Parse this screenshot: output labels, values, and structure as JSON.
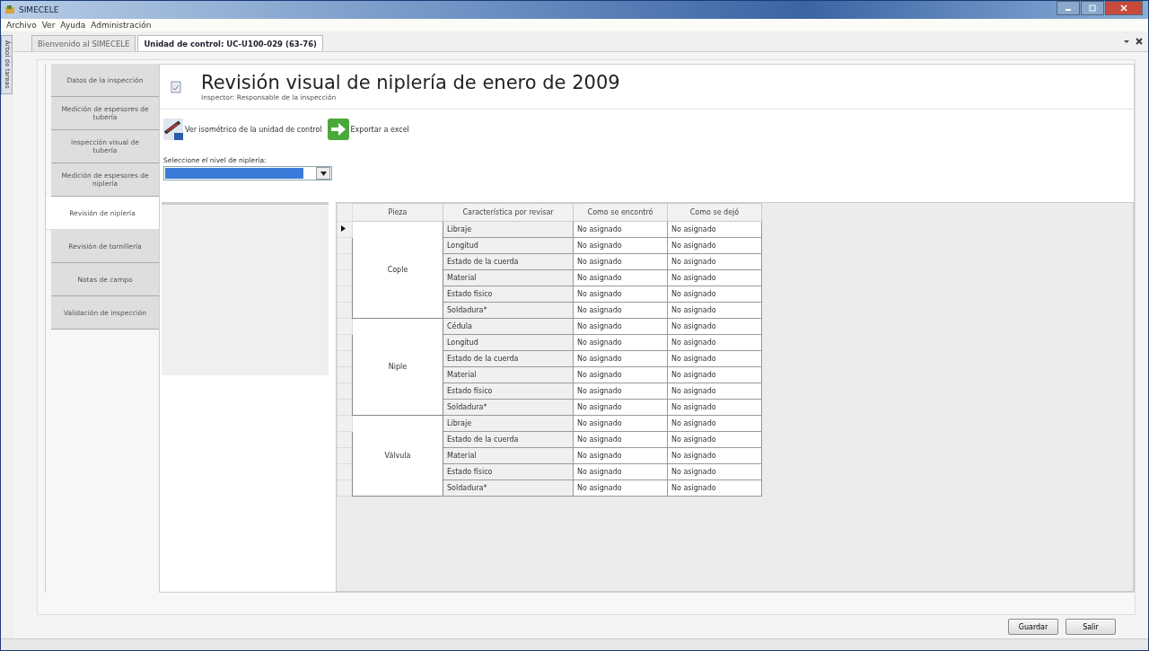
{
  "window": {
    "title": "SIMECELE"
  },
  "menu": [
    "Archivo",
    "Ver",
    "Ayuda",
    "Administración"
  ],
  "side_panel_tab": "Árbol de tareas",
  "doc_tabs": [
    {
      "label": "Bienvenido al SIMECELE",
      "selected": false
    },
    {
      "label": "Unidad de control: UC-U100-029 (63-76)",
      "selected": true
    }
  ],
  "nav_tabs": [
    {
      "label": "Datos de la inspección",
      "selected": false
    },
    {
      "label": "Medición de espesores de tubería",
      "selected": false
    },
    {
      "label": "Inspección visual de tubería",
      "selected": false
    },
    {
      "label": "Medición de espesores de niplería",
      "selected": false
    },
    {
      "label": "Revisión de niplería",
      "selected": true
    },
    {
      "label": "Revisión de tornillería",
      "selected": false
    },
    {
      "label": "Notas de campo",
      "selected": false
    },
    {
      "label": "Validación de inspección",
      "selected": false
    }
  ],
  "header": {
    "title": "Revisión visual de niplería de enero de 2009",
    "subtitle": "Inspector: Responsable de la inspección"
  },
  "toolbar": [
    {
      "kind": "isometric",
      "label": "Ver isométrico de la unidad de control"
    },
    {
      "kind": "export",
      "label": "Exportar a excel"
    }
  ],
  "level_select": {
    "label": "Seleccione el nivel de niplería:"
  },
  "table": {
    "columns": [
      "Pieza",
      "Característica por revisar",
      "Como se encontró",
      "Como se dejó"
    ],
    "groups": [
      {
        "pieza": "Cople",
        "rows": [
          {
            "caracteristica": "Libraje",
            "encontro": "No asignado",
            "dejo": "No asignado",
            "current": true
          },
          {
            "caracteristica": "Longitud",
            "encontro": "No asignado",
            "dejo": "No asignado",
            "current": false
          },
          {
            "caracteristica": "Estado de la cuerda",
            "encontro": "No asignado",
            "dejo": "No asignado",
            "current": false
          },
          {
            "caracteristica": "Material",
            "encontro": "No asignado",
            "dejo": "No asignado",
            "current": false
          },
          {
            "caracteristica": "Estado físico",
            "encontro": "No asignado",
            "dejo": "No asignado",
            "current": false
          },
          {
            "caracteristica": "Soldadura*",
            "encontro": "No asignado",
            "dejo": "No asignado",
            "current": false
          }
        ]
      },
      {
        "pieza": "Niple",
        "rows": [
          {
            "caracteristica": "Cédula",
            "encontro": "No asignado",
            "dejo": "No asignado",
            "current": false
          },
          {
            "caracteristica": "Longitud",
            "encontro": "No asignado",
            "dejo": "No asignado",
            "current": false
          },
          {
            "caracteristica": "Estado de la cuerda",
            "encontro": "No asignado",
            "dejo": "No asignado",
            "current": false
          },
          {
            "caracteristica": "Material",
            "encontro": "No asignado",
            "dejo": "No asignado",
            "current": false
          },
          {
            "caracteristica": "Estado físico",
            "encontro": "No asignado",
            "dejo": "No asignado",
            "current": false
          },
          {
            "caracteristica": "Soldadura*",
            "encontro": "No asignado",
            "dejo": "No asignado",
            "current": false
          }
        ]
      },
      {
        "pieza": "Válvula",
        "rows": [
          {
            "caracteristica": "Libraje",
            "encontro": "No asignado",
            "dejo": "No asignado",
            "current": false
          },
          {
            "caracteristica": "Estado de la cuerda",
            "encontro": "No asignado",
            "dejo": "No asignado",
            "current": false
          },
          {
            "caracteristica": "Material",
            "encontro": "No asignado",
            "dejo": "No asignado",
            "current": false
          },
          {
            "caracteristica": "Estado físico",
            "encontro": "No asignado",
            "dejo": "No asignado",
            "current": false
          },
          {
            "caracteristica": "Soldadura*",
            "encontro": "No asignado",
            "dejo": "No asignado",
            "current": false
          }
        ]
      }
    ]
  },
  "buttons": [
    "Guardar",
    "Salir"
  ]
}
